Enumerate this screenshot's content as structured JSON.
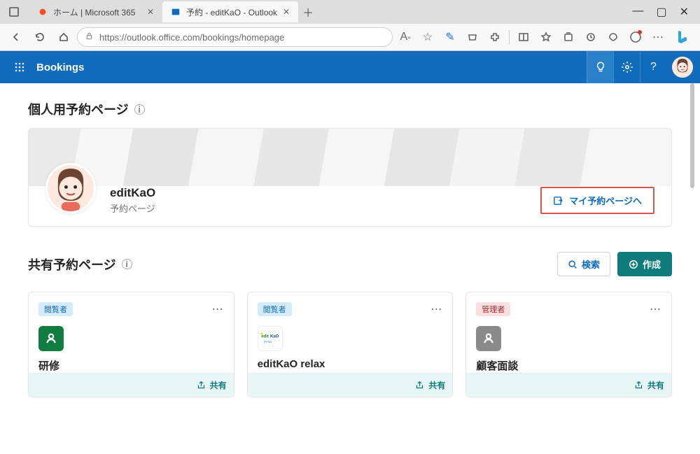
{
  "browser": {
    "tabs": [
      {
        "title": "ホーム | Microsoft 365",
        "active": false
      },
      {
        "title": "予約 - editKaO - Outlook",
        "active": true
      }
    ],
    "url": "https://outlook.office.com/bookings/homepage"
  },
  "app": {
    "name": "Bookings"
  },
  "personal": {
    "heading": "個人用予約ページ",
    "name": "editKaO",
    "subtitle": "予約ページ",
    "button": "マイ予約ページへ"
  },
  "shared": {
    "heading": "共有予約ページ",
    "search": "検索",
    "create": "作成",
    "shareLabel": "共有",
    "cards": [
      {
        "role": "閲覧者",
        "roleClass": "",
        "iconType": "person",
        "title": "研修"
      },
      {
        "role": "閲覧者",
        "roleClass": "",
        "iconType": "logo",
        "title": "editKaO relax"
      },
      {
        "role": "管理者",
        "roleClass": "admin",
        "iconType": "person-grey",
        "title": "顧客面談"
      }
    ]
  }
}
